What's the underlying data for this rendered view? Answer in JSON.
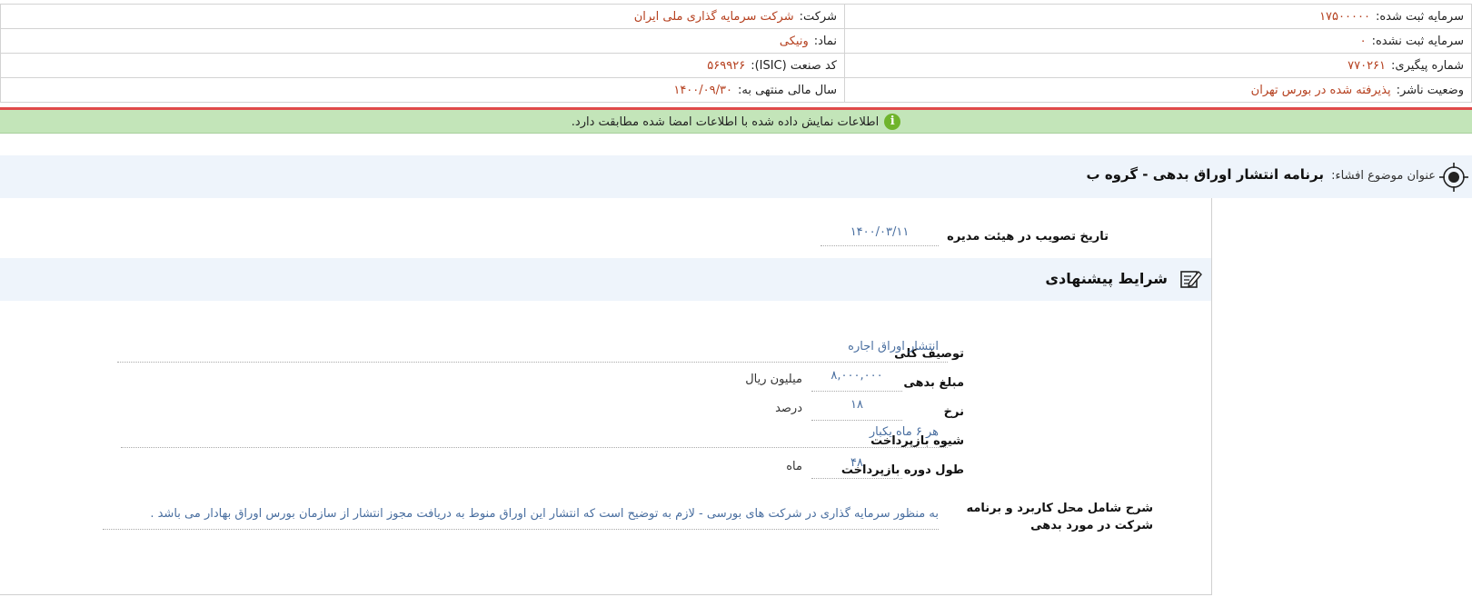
{
  "header": {
    "company_label": "شرکت:",
    "company_value": "شرکت سرمایه گذاری ملی ایران",
    "registered_capital_label": "سرمایه ثبت شده:",
    "registered_capital_value": "۱۷۵۰۰۰۰۰",
    "symbol_label": "نماد:",
    "symbol_value": "ونیکی",
    "unregistered_capital_label": "سرمایه ثبت نشده:",
    "unregistered_capital_value": "۰",
    "isic_label": "کد صنعت (ISIC):",
    "isic_value": "۵۶۹۹۲۶",
    "tracking_label": "شماره پیگیری:",
    "tracking_value": "۷۷۰۲۶۱",
    "fiscal_year_label": "سال مالی منتهی به:",
    "fiscal_year_value": "۱۴۰۰/۰۹/۳۰",
    "publisher_status_label": "وضعیت ناشر:",
    "publisher_status_value": "پذیرفته شده در بورس تهران"
  },
  "notice": {
    "icon": "info-icon",
    "text": "اطلاعات نمایش داده شده با اطلاعات امضا شده مطابقت دارد."
  },
  "subject": {
    "label": "عنوان موضوع افشاء:",
    "title": "برنامه انتشار اوراق بدهی - گروه ب",
    "icon": "target-icon"
  },
  "board": {
    "label": "تاریخ تصویب در هیئت مدیره",
    "value": "۱۴۰۰/۰۳/۱۱"
  },
  "section": {
    "title": "شرایط پیشنهادی",
    "icon": "edit-document-icon"
  },
  "fields": {
    "description_label": "توصیف کلی",
    "description_value": "انتشار اوراق اجاره",
    "amount_label": "مبلغ بدهی",
    "amount_value": "۸,۰۰۰,۰۰۰",
    "amount_unit": "میلیون ریال",
    "rate_label": "نرخ",
    "rate_value": "۱۸",
    "rate_unit": "درصد",
    "repayment_method_label": "شیوه بازپرداخت",
    "repayment_method_value": "هر ۶ ماه یکبار",
    "repayment_period_label": "طول دوره بازپرداخت",
    "repayment_period_value": "۴۸",
    "repayment_period_unit": "ماه",
    "usage_label": "شرح شامل محل کاربرد و برنامه شرکت در مورد بدهی",
    "usage_value": "به منظور سرمایه گذاری در شرکت های بورسی - لازم به توضیح است که انتشار این اوراق منوط به دریافت مجوز انتشار از سازمان بورس اوراق بهادار می باشد ."
  },
  "colors": {
    "value_red": "#b5401f",
    "value_blue": "#4a6fa0",
    "notice_bg": "#c3e5b9",
    "alert_line": "#e04a4a",
    "band_bg": "#eef4fb"
  }
}
